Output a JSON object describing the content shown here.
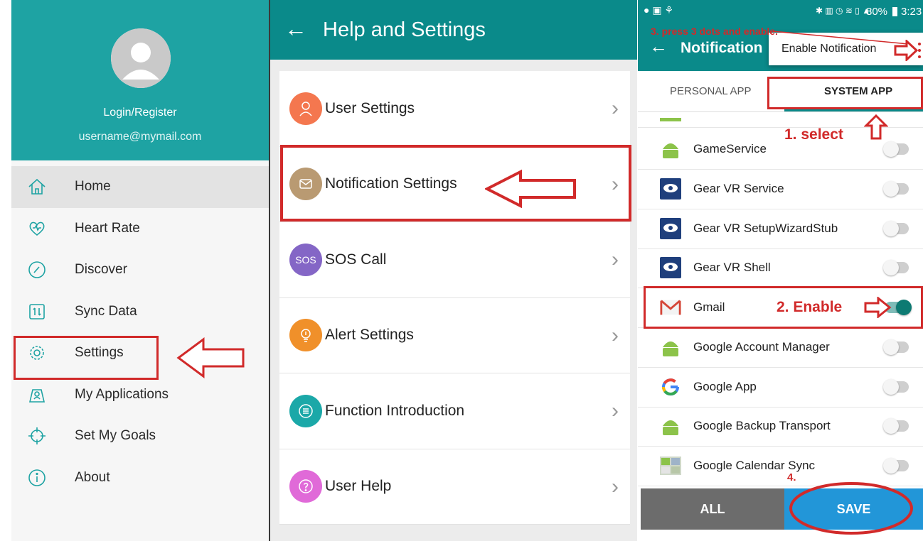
{
  "sidebar": {
    "login_label": "Login/Register",
    "email": "username@mymail.com",
    "items": [
      {
        "label": "Home",
        "icon": "home-icon"
      },
      {
        "label": "Heart Rate",
        "icon": "heart-rate-icon"
      },
      {
        "label": "Discover",
        "icon": "compass-icon"
      },
      {
        "label": "Sync Data",
        "icon": "sync-icon"
      },
      {
        "label": "Settings",
        "icon": "gear-icon"
      },
      {
        "label": "My Applications",
        "icon": "applications-icon"
      },
      {
        "label": "Set My Goals",
        "icon": "target-icon"
      },
      {
        "label": "About",
        "icon": "info-icon"
      }
    ]
  },
  "help": {
    "back_icon": "←",
    "title": "Help and Settings",
    "items": [
      {
        "label": "User Settings",
        "color": "#f4774f",
        "icon": "user-icon"
      },
      {
        "label": "Notification Settings",
        "color": "#b99a72",
        "icon": "message-icon"
      },
      {
        "label": "SOS Call",
        "color": "#8466c6",
        "icon_text": "SOS"
      },
      {
        "label": "Alert Settings",
        "color": "#f0902a",
        "icon": "bulb-icon"
      },
      {
        "label": "Function Introduction",
        "color": "#1ba8a8",
        "icon": "list-icon"
      },
      {
        "label": "User Help",
        "color": "#e06ad8",
        "icon": "help-icon"
      }
    ],
    "chevron": "›"
  },
  "notifications": {
    "status_time": "3:23 PM",
    "status_battery": "80%",
    "back_icon": "←",
    "title": "Notification",
    "popup": "Enable Notification",
    "tabs": [
      "PERSONAL APP",
      "SYSTEM APP"
    ],
    "apps": [
      {
        "name": "GameService",
        "icon": "android-icon",
        "on": false
      },
      {
        "name": "Gear VR Service",
        "icon": "gear-vr-icon",
        "on": false
      },
      {
        "name": "Gear VR SetupWizardStub",
        "icon": "gear-vr-icon",
        "on": false
      },
      {
        "name": "Gear VR Shell",
        "icon": "gear-vr-icon",
        "on": false
      },
      {
        "name": "Gmail",
        "icon": "gmail-icon",
        "on": true
      },
      {
        "name": "Google Account Manager",
        "icon": "android-icon",
        "on": false
      },
      {
        "name": "Google App",
        "icon": "google-icon",
        "on": false
      },
      {
        "name": "Google Backup Transport",
        "icon": "android-icon",
        "on": false
      },
      {
        "name": "Google Calendar Sync",
        "icon": "calendar-sync-icon",
        "on": false
      }
    ],
    "all_label": "ALL",
    "save_label": "SAVE"
  },
  "annotations": {
    "step1": "1. select",
    "step2": "2. Enable",
    "step3": "3. press 3 dots and enable.",
    "step4": "4."
  },
  "colors": {
    "teal_header": "#1ea3a3",
    "teal_bar": "#0a8a8a",
    "annotation_red": "#d12a2a",
    "save_blue": "#2296d8",
    "all_grey": "#6c6c6c"
  }
}
